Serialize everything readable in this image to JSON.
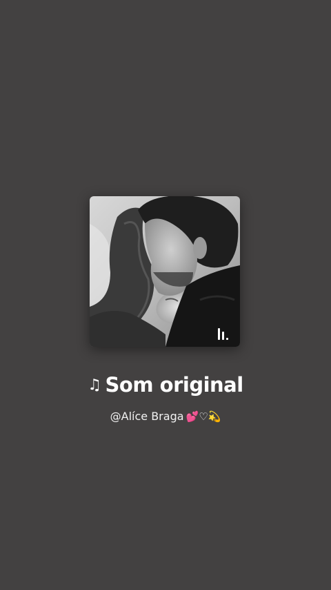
{
  "sound": {
    "note_icon": "♫",
    "title": "Som original",
    "artist_line": "@Alíce Braga",
    "artist_emoji": "💕♡💫"
  },
  "cover": {
    "description_icon": "album-cover-image",
    "brand_icon": "music-brand-icon"
  },
  "colors": {
    "background": "#434141",
    "text": "#ffffff"
  }
}
